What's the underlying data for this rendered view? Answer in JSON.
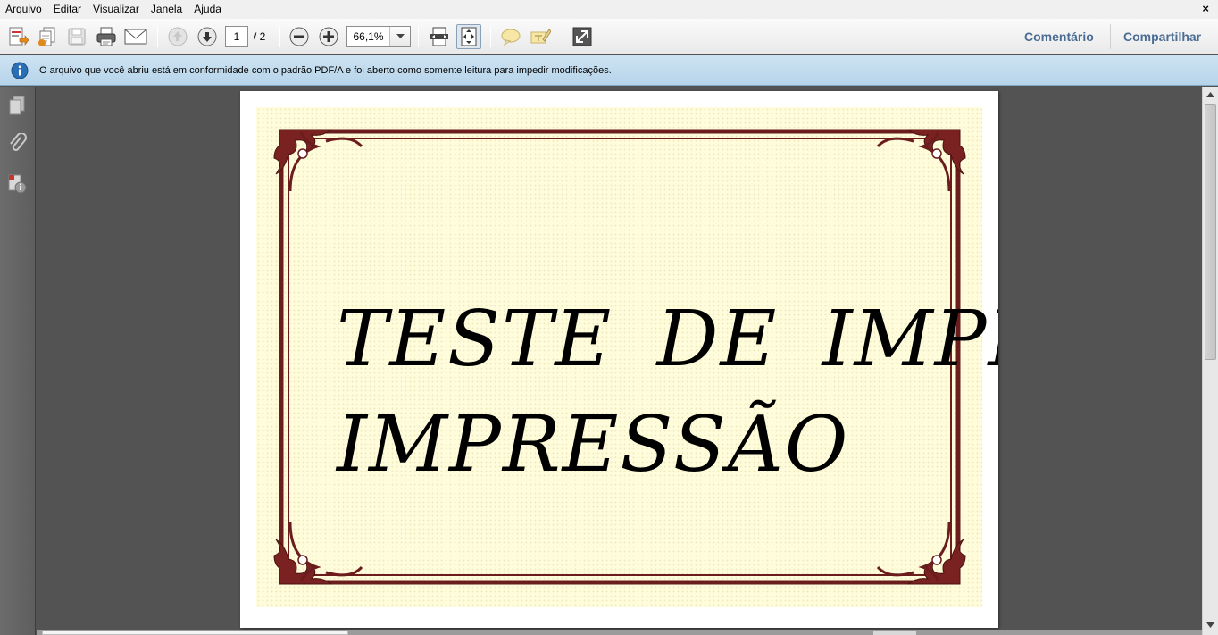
{
  "menubar": {
    "items": [
      "Arquivo",
      "Editar",
      "Visualizar",
      "Janela",
      "Ajuda"
    ],
    "close": "×"
  },
  "toolbar": {
    "page_current": "1",
    "page_total": "/ 2",
    "zoom": "66,1%",
    "comment_label": "Comentário",
    "share_label": "Compartilhar",
    "icons": [
      "create-pdf-icon",
      "combine-files-icon",
      "save-icon",
      "print-icon",
      "email-icon",
      "previous-page-icon",
      "next-page-icon",
      "zoom-out-icon",
      "zoom-in-icon",
      "fit-width-icon",
      "fit-page-icon",
      "sticky-note-icon",
      "highlight-icon",
      "full-screen-icon"
    ]
  },
  "infobar": {
    "icon": "info-icon",
    "message": "O arquivo que você abriu está em conformidade com o padrão PDF/A e foi aberto como somente leitura para impedir modificações."
  },
  "leftpane": {
    "icons": [
      "page-thumbnails-icon",
      "attachments-icon",
      "standards-icon"
    ]
  },
  "document": {
    "line1": "TESTE DE IMPRESSÃO",
    "line2": "IMPRESSÃO"
  },
  "colors": {
    "frame": "#6b1d1d",
    "parchment": "#fefcdb",
    "link": "#4b6d94",
    "infobar": "#c3dbee"
  }
}
